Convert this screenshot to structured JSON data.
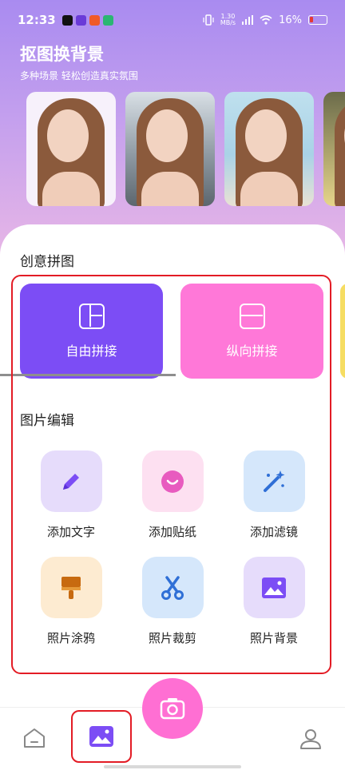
{
  "status_bar": {
    "time": "12:33",
    "speed_value": "1.30",
    "speed_unit": "MB/s",
    "battery": "16%"
  },
  "hero": {
    "title": "抠图换背景",
    "subtitle": "多种场景 轻松创造真实氛围"
  },
  "collage": {
    "title": "创意拼图",
    "cards": [
      {
        "label": "自由拼接",
        "color": "#7c4df5"
      },
      {
        "label": "纵向拼接",
        "color": "#ff78d8"
      }
    ]
  },
  "edit": {
    "title": "图片编辑",
    "tools": [
      {
        "label": "添加文字",
        "icon": "pencil-icon"
      },
      {
        "label": "添加贴纸",
        "icon": "smile-sticker-icon"
      },
      {
        "label": "添加滤镜",
        "icon": "magic-wand-icon"
      },
      {
        "label": "照片涂鸦",
        "icon": "brush-icon"
      },
      {
        "label": "照片裁剪",
        "icon": "scissors-icon"
      },
      {
        "label": "照片背景",
        "icon": "image-icon"
      }
    ]
  },
  "nav": {
    "items": [
      {
        "icon": "home-icon"
      },
      {
        "icon": "gallery-icon",
        "active": true
      },
      {
        "icon": "camera-icon"
      },
      {
        "icon": "user-icon"
      }
    ]
  },
  "colors": {
    "accent_purple": "#7c4df5",
    "accent_pink": "#ff6fd3",
    "highlight_red": "#e31c25"
  }
}
